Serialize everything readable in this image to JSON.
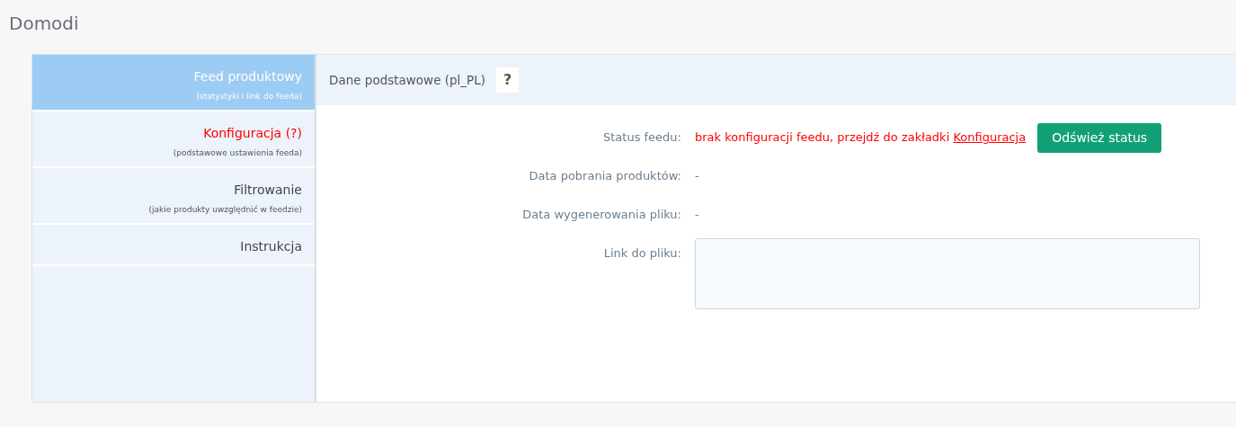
{
  "page_title": "Domodi",
  "sidebar": {
    "items": [
      {
        "label": "Feed produktowy",
        "subtitle": "(statystyki i link do feeda)",
        "selected": true,
        "warning": false
      },
      {
        "label": "Konfiguracja (?)",
        "subtitle": "(podstawowe ustawienia feeda)",
        "selected": false,
        "warning": true
      },
      {
        "label": "Filtrowanie",
        "subtitle": "(jakie produkty uwzględnić w feedzie)",
        "selected": false,
        "warning": false
      },
      {
        "label": "Instrukcja",
        "selected": false,
        "warning": false
      }
    ]
  },
  "panel": {
    "title": "Dane podstawowe (pl_PL)",
    "help": "?",
    "rows": [
      {
        "kind": "status",
        "label": "Status feedu:",
        "value": "brak konfiguracji feedu, przejdź do zakładki",
        "link": "Konfiguracja",
        "button": "Odśwież status"
      },
      {
        "kind": "text",
        "label": "Data pobrania produktów:",
        "value": "-"
      },
      {
        "kind": "text",
        "label": "Data wygenerowania pliku:",
        "value": "-"
      },
      {
        "kind": "textarea",
        "label": "Link do pliku:"
      }
    ]
  }
}
